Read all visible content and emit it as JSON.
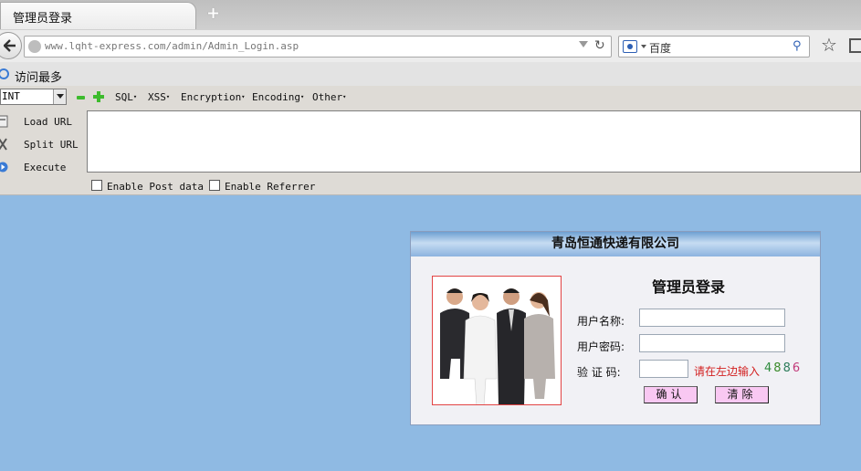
{
  "browser": {
    "tab_title": "管理员登录",
    "new_tab": "+",
    "url_host": "www.lqht-express.com",
    "url_path": "/admin/Admin_Login.asp",
    "search_placeholder": "百度",
    "reload_glyph": "C"
  },
  "bookmarks": {
    "items": [
      {
        "label": "访问最多"
      }
    ]
  },
  "hackbar": {
    "selected_type": "INT",
    "menus": [
      "SQL",
      "XSS",
      "Encryption",
      "Encoding",
      "Other"
    ],
    "actions": [
      "Load URL",
      "Split URL",
      "Execute"
    ],
    "url_value": "",
    "options": [
      "Enable Post data",
      "Enable Referrer"
    ]
  },
  "login": {
    "company": "青岛恒通快递有限公司",
    "title": "管理员登录",
    "username_label": "用户名称:",
    "password_label": "用户密码:",
    "captcha_label": "验 证 码:",
    "username_value": "",
    "password_value": "",
    "captcha_value": "",
    "captcha_hint": "请在左边输入",
    "captcha_digits": [
      {
        "digit": "4",
        "color": "#2e8b3e"
      },
      {
        "digit": "8",
        "color": "#3a8a2a"
      },
      {
        "digit": "8",
        "color": "#2e7d5b"
      },
      {
        "digit": "6",
        "color": "#c23a7a"
      }
    ],
    "confirm_button": "确认",
    "clear_button": "清除"
  },
  "colors": {
    "page_background": "#8fbae3",
    "button_pink": "#f9c8f2",
    "hint_red": "#d21f1f"
  }
}
